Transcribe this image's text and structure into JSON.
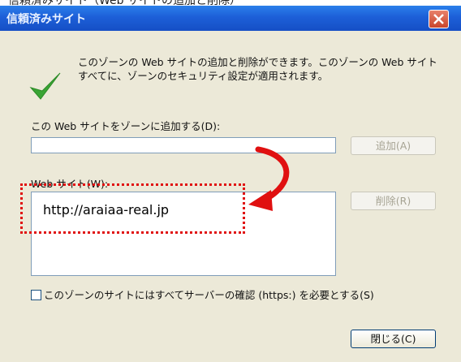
{
  "top_strip_text": "信頼済みサイト（Web サイトの追加と削除）",
  "title": "信頼済みサイト",
  "description": "このゾーンの Web サイトの追加と削除ができます。このゾーンの Web サイトすべてに、ゾーンのセキュリティ設定が適用されます。",
  "add_label": "この Web サイトをゾーンに追加する(D):",
  "add_input_value": "",
  "add_button": "追加(A)",
  "sites_label": "Web サイト(W):",
  "sites": [
    "http://araiaa-real.jp"
  ],
  "remove_button": "削除(R)",
  "https_label": "このゾーンのサイトにはすべてサーバーの確認 (https:) を必要とする(S)",
  "https_checked": false,
  "close_button": "閉じる(C)",
  "icons": {
    "close": "close-icon",
    "check": "checkmark-icon",
    "arrow": "curved-arrow-annotation"
  },
  "colors": {
    "titlebar": "#1d5fd8",
    "dialog_bg": "#ece9d8",
    "annotation": "#e01010"
  }
}
